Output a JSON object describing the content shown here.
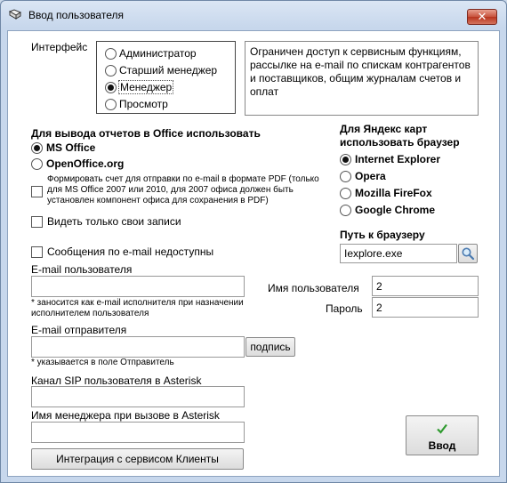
{
  "window": {
    "title": "Ввод пользователя",
    "close_label": "✕"
  },
  "interface": {
    "label": "Интерфейс",
    "options": [
      "Администратор",
      "Старший менеджер",
      "Менеджер",
      "Просмотр"
    ],
    "selected": "Менеджер",
    "description": "Ограничен доступ к сервисным функциям, рассылке на e-mail по спискам контрагентов и поставщиков, общим журналам счетов и оплат"
  },
  "office": {
    "heading": "Для вывода отчетов в Office использовать",
    "options": [
      "MS Office",
      "OpenOffice.org"
    ],
    "selected": "MS Office",
    "pdf_note": "Формировать счет для отправки по e-mail в формате PDF (только для MS Office 2007 или 2010, для 2007 офиса должен быть установлен компонент офиса для  сохранения в PDF)",
    "pdf_checked": false,
    "own_records_label": "Видеть только свои записи",
    "own_records_checked": false,
    "email_unavailable_label": "Сообщения по e-mail недоступны",
    "email_unavailable_checked": false
  },
  "yandex": {
    "heading": "Для Яндекс карт использовать браузер",
    "options": [
      "Internet Explorer",
      "Opera",
      "Mozilla FireFox",
      "Google Chrome"
    ],
    "selected": "Internet Explorer",
    "browser_path_label": "Путь к браузеру",
    "browser_path_value": "Iexplore.exe"
  },
  "user": {
    "email_label": "E-mail пользователя",
    "email_value": "",
    "email_note": "* заносится как e-mail исполнителя при назначении исполнителем пользователя",
    "username_label": "Имя пользователя",
    "username_value": "2",
    "password_label": "Пароль",
    "password_value": "2",
    "sender_email_label": "E-mail отправителя",
    "sender_email_value": "",
    "signature_button": "подпись",
    "sender_note": "* указывается в поле Отправитель",
    "sip_label": "Канал SIP пользователя в Asterisk",
    "sip_value": "",
    "manager_name_label": "Имя менеджера при вызове в Asterisk",
    "manager_name_value": "",
    "integration_button": "Интеграция с сервисом Клиенты",
    "submit_label": "Ввод",
    "submit_icon_color": "#2e9a2e"
  }
}
